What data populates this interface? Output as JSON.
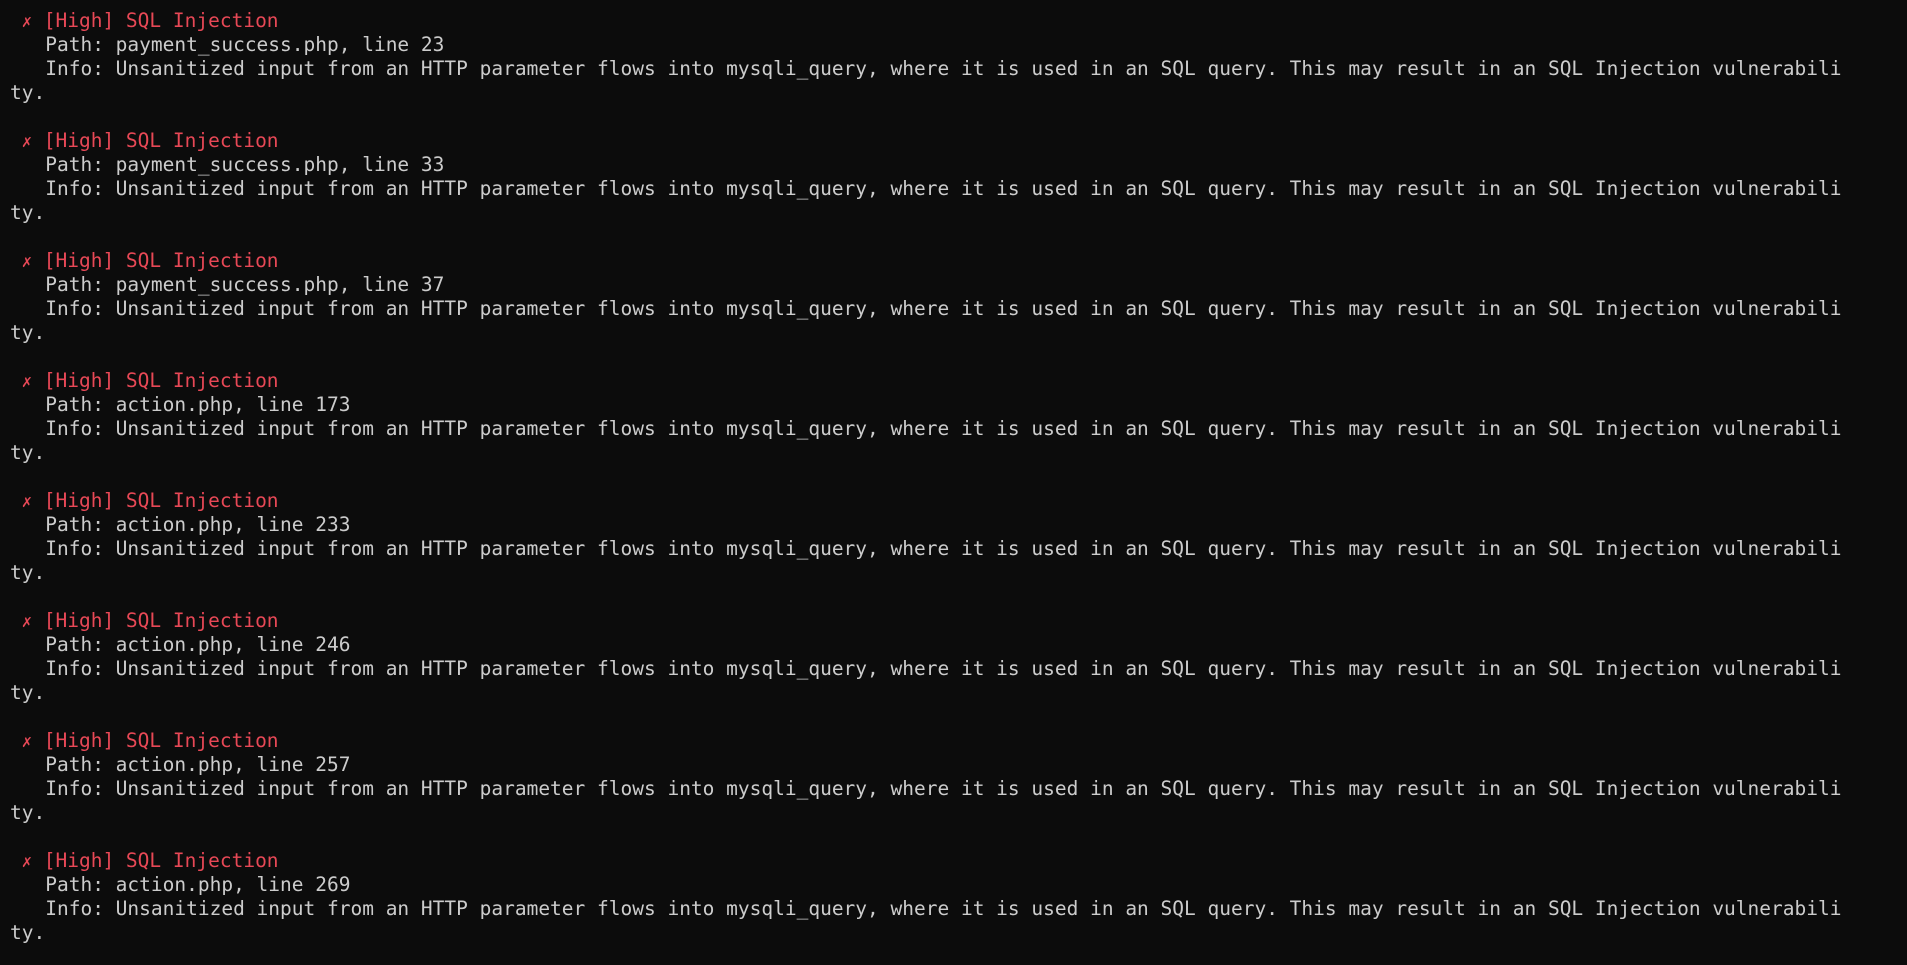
{
  "theme": {
    "background": "#0c0c0c",
    "text": "#cccccc",
    "severity_high": "#e74856"
  },
  "issue_marker": "✗",
  "issues": [
    {
      "title": "[High] SQL Injection",
      "path": "Path: payment_success.php, line 23",
      "info": "Info: Unsanitized input from an HTTP parameter flows into mysqli_query, where it is used in an SQL query. This may result in an SQL Injection vulnerabili",
      "info_wrap": "ty."
    },
    {
      "title": "[High] SQL Injection",
      "path": "Path: payment_success.php, line 33",
      "info": "Info: Unsanitized input from an HTTP parameter flows into mysqli_query, where it is used in an SQL query. This may result in an SQL Injection vulnerabili",
      "info_wrap": "ty."
    },
    {
      "title": "[High] SQL Injection",
      "path": "Path: payment_success.php, line 37",
      "info": "Info: Unsanitized input from an HTTP parameter flows into mysqli_query, where it is used in an SQL query. This may result in an SQL Injection vulnerabili",
      "info_wrap": "ty."
    },
    {
      "title": "[High] SQL Injection",
      "path": "Path: action.php, line 173",
      "info": "Info: Unsanitized input from an HTTP parameter flows into mysqli_query, where it is used in an SQL query. This may result in an SQL Injection vulnerabili",
      "info_wrap": "ty."
    },
    {
      "title": "[High] SQL Injection",
      "path": "Path: action.php, line 233",
      "info": "Info: Unsanitized input from an HTTP parameter flows into mysqli_query, where it is used in an SQL query. This may result in an SQL Injection vulnerabili",
      "info_wrap": "ty."
    },
    {
      "title": "[High] SQL Injection",
      "path": "Path: action.php, line 246",
      "info": "Info: Unsanitized input from an HTTP parameter flows into mysqli_query, where it is used in an SQL query. This may result in an SQL Injection vulnerabili",
      "info_wrap": "ty."
    },
    {
      "title": "[High] SQL Injection",
      "path": "Path: action.php, line 257",
      "info": "Info: Unsanitized input from an HTTP parameter flows into mysqli_query, where it is used in an SQL query. This may result in an SQL Injection vulnerabili",
      "info_wrap": "ty."
    },
    {
      "title": "[High] SQL Injection",
      "path": "Path: action.php, line 269",
      "info": "Info: Unsanitized input from an HTTP parameter flows into mysqli_query, where it is used in an SQL query. This may result in an SQL Injection vulnerabili",
      "info_wrap": "ty."
    }
  ]
}
